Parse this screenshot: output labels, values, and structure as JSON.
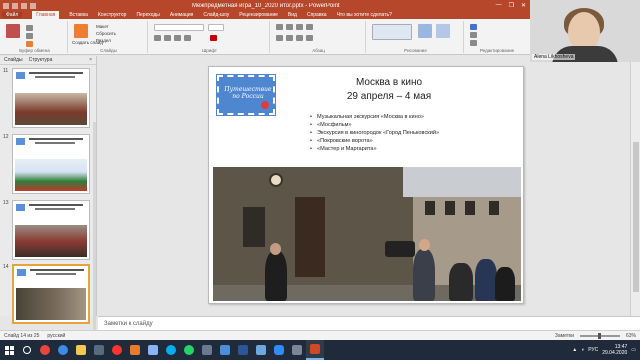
{
  "window": {
    "title": "Межпредметная игра_10_2020 итог.pptx - PowerPoint",
    "min": "—",
    "restore": "❐",
    "close": "✕"
  },
  "ribbon_tabs": [
    "Файл",
    "Главная",
    "Вставка",
    "Конструктор",
    "Переходы",
    "Анимация",
    "Слайд-шоу",
    "Рецензирование",
    "Вид",
    "Справка",
    "Что вы хотите сделать?"
  ],
  "ribbon_groups": {
    "clipboard": "Буфер обмена",
    "slides": "Слайды",
    "font": "Шрифт",
    "paragraph": "Абзац",
    "drawing": "Рисование",
    "editing": "Редактирование",
    "create_slide": "Создать слайд",
    "layout": "Макет",
    "reset": "Сбросить",
    "section": "Раздел"
  },
  "webcam": {
    "name": "Alena Likhosheva"
  },
  "thumbnail_pane": {
    "tabs": [
      "Слайды",
      "Структура"
    ],
    "close": "×",
    "slides": [
      {
        "number": "11",
        "selected": false
      },
      {
        "number": "12",
        "selected": false
      },
      {
        "number": "13",
        "selected": false
      },
      {
        "number": "14",
        "selected": true
      }
    ]
  },
  "slide": {
    "stamp_text": "Путешествие по России",
    "title": "Москва в кино",
    "date": "29 апреля – 4 мая",
    "bullets": [
      "Музыкальная экскурсия «Москва в кино»",
      "«Мосфильм»",
      "Экскурсия в киногородок «Город Пеньковский»",
      "«Покровские ворота»",
      "«Мастер и Маргарита»"
    ]
  },
  "notes": {
    "placeholder": "Заметки к слайду"
  },
  "status": {
    "slide": "Слайд 14 из 25",
    "language": "русский",
    "notes_btn": "Заметки",
    "zoom": "63%"
  },
  "tray": {
    "lang": "РУС",
    "time": "13:47",
    "date": "29.04.2020"
  },
  "colors": {
    "accent": "#b7472a",
    "taskbar": "#1f2a3a",
    "selected_thumb": "#e8a33b"
  }
}
